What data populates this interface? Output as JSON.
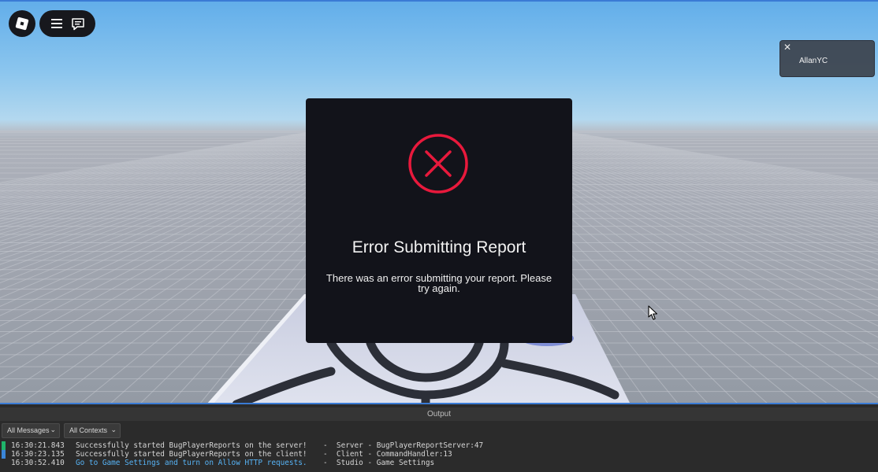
{
  "topbar": {
    "logo_icon": "roblox-logo-icon",
    "menu_icon": "hamburger-menu-icon",
    "chat_icon": "chat-bubble-icon"
  },
  "player_toast": {
    "name": "AllanYC",
    "close_glyph": "✕"
  },
  "dialog": {
    "title": "Error Submitting Report",
    "message": "There was an error submitting your report. Please try again.",
    "icon": "error-x-circle-icon",
    "accent_color": "#e8193c"
  },
  "output": {
    "title": "Output",
    "filter_messages": "All Messages",
    "filter_contexts": "All Contexts",
    "lines": [
      {
        "time": "16:30:21.843",
        "message": "Successfully started BugPlayerReports on the server!",
        "source": "-  Server - BugPlayerReportServer:47",
        "marker_color": "#1fb46a"
      },
      {
        "time": "16:30:23.135",
        "message": "Successfully started BugPlayerReports on the client!",
        "source": "-  Client - CommandHandler:13",
        "marker_color": "#3a86d8"
      },
      {
        "time": "16:30:52.410",
        "message": "Go to Game Settings and turn on Allow HTTP requests.",
        "source": "-  Studio - Game Settings",
        "marker_color": ""
      }
    ]
  }
}
